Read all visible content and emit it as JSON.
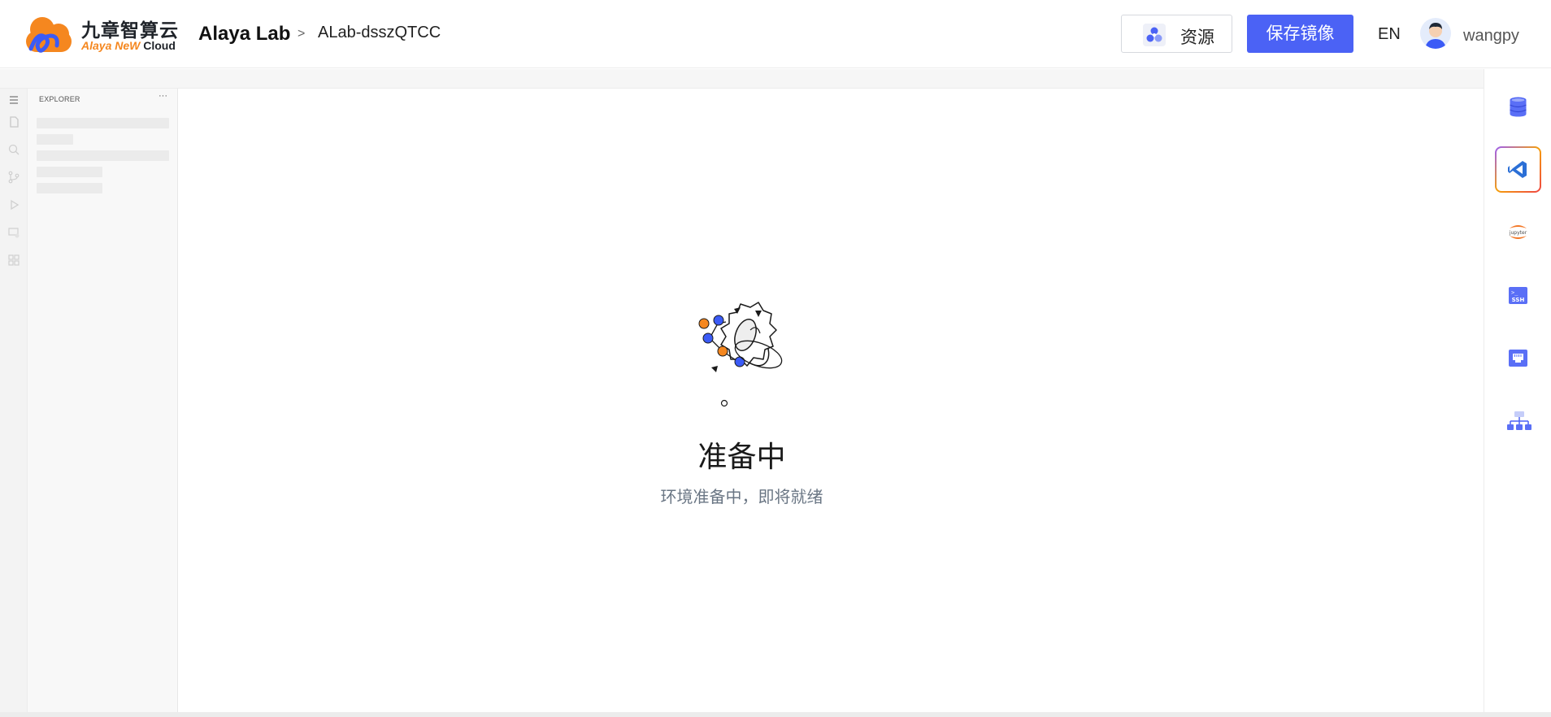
{
  "header": {
    "logo_cn": "九章智算云",
    "logo_en_part1": "Alaya NeW",
    "logo_en_part2": "Cloud",
    "app_title": "Alaya Lab",
    "breadcrumb_sep": ">",
    "breadcrumb_item": "ALab-dsszQTCC",
    "resource_label": "资源",
    "save_image_label": "保存镜像",
    "lang_label": "EN",
    "username": "wangpy"
  },
  "sidebar": {
    "title": "EXPLORER",
    "more": "···"
  },
  "loading": {
    "title": "准备中",
    "subtitle": "环境准备中，即将就绪"
  },
  "colors": {
    "accent": "#4b62f5",
    "logo_orange": "#f5871f",
    "logo_blue": "#3b5bf6"
  },
  "right_toolbar": [
    "database-icon",
    "vscode-icon",
    "jupyter-icon",
    "ssh-icon",
    "network-port-icon",
    "cluster-icon"
  ]
}
